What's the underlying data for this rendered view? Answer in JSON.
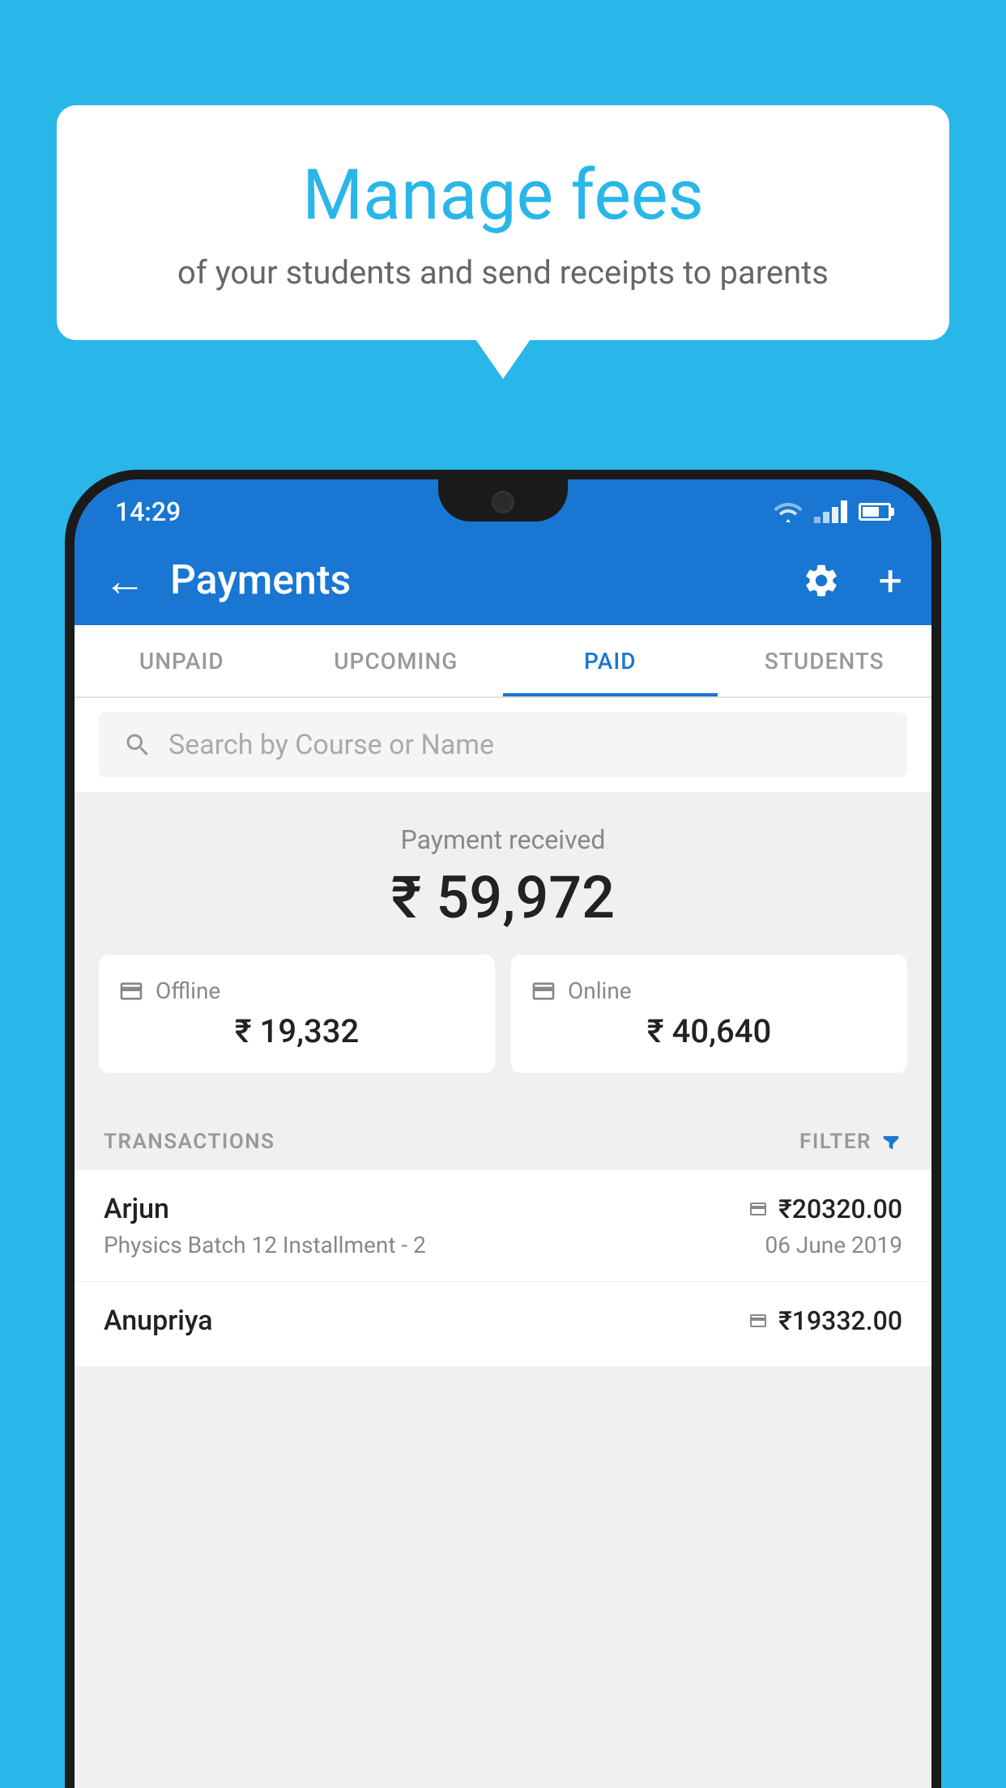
{
  "background_color": "#29b6e8",
  "bubble": {
    "title": "Manage fees",
    "subtitle": "of your students and send receipts to parents"
  },
  "status_bar": {
    "time": "14:29",
    "color": "#1976d2"
  },
  "app_bar": {
    "title": "Payments",
    "back_label": "←",
    "plus_label": "+",
    "color": "#1976d2"
  },
  "tabs": [
    {
      "label": "UNPAID",
      "active": false
    },
    {
      "label": "UPCOMING",
      "active": false
    },
    {
      "label": "PAID",
      "active": true
    },
    {
      "label": "STUDENTS",
      "active": false
    }
  ],
  "search": {
    "placeholder": "Search by Course or Name"
  },
  "payment": {
    "received_label": "Payment received",
    "amount": "₹ 59,972",
    "offline_label": "Offline",
    "offline_amount": "₹ 19,332",
    "online_label": "Online",
    "online_amount": "₹ 40,640"
  },
  "transactions": {
    "header_label": "TRANSACTIONS",
    "filter_label": "FILTER",
    "rows": [
      {
        "name": "Arjun",
        "amount": "₹20320.00",
        "description": "Physics Batch 12 Installment - 2",
        "date": "06 June 2019",
        "payment_type": "online"
      },
      {
        "name": "Anupriya",
        "amount": "₹19332.00",
        "description": "",
        "date": "",
        "payment_type": "offline"
      }
    ]
  }
}
